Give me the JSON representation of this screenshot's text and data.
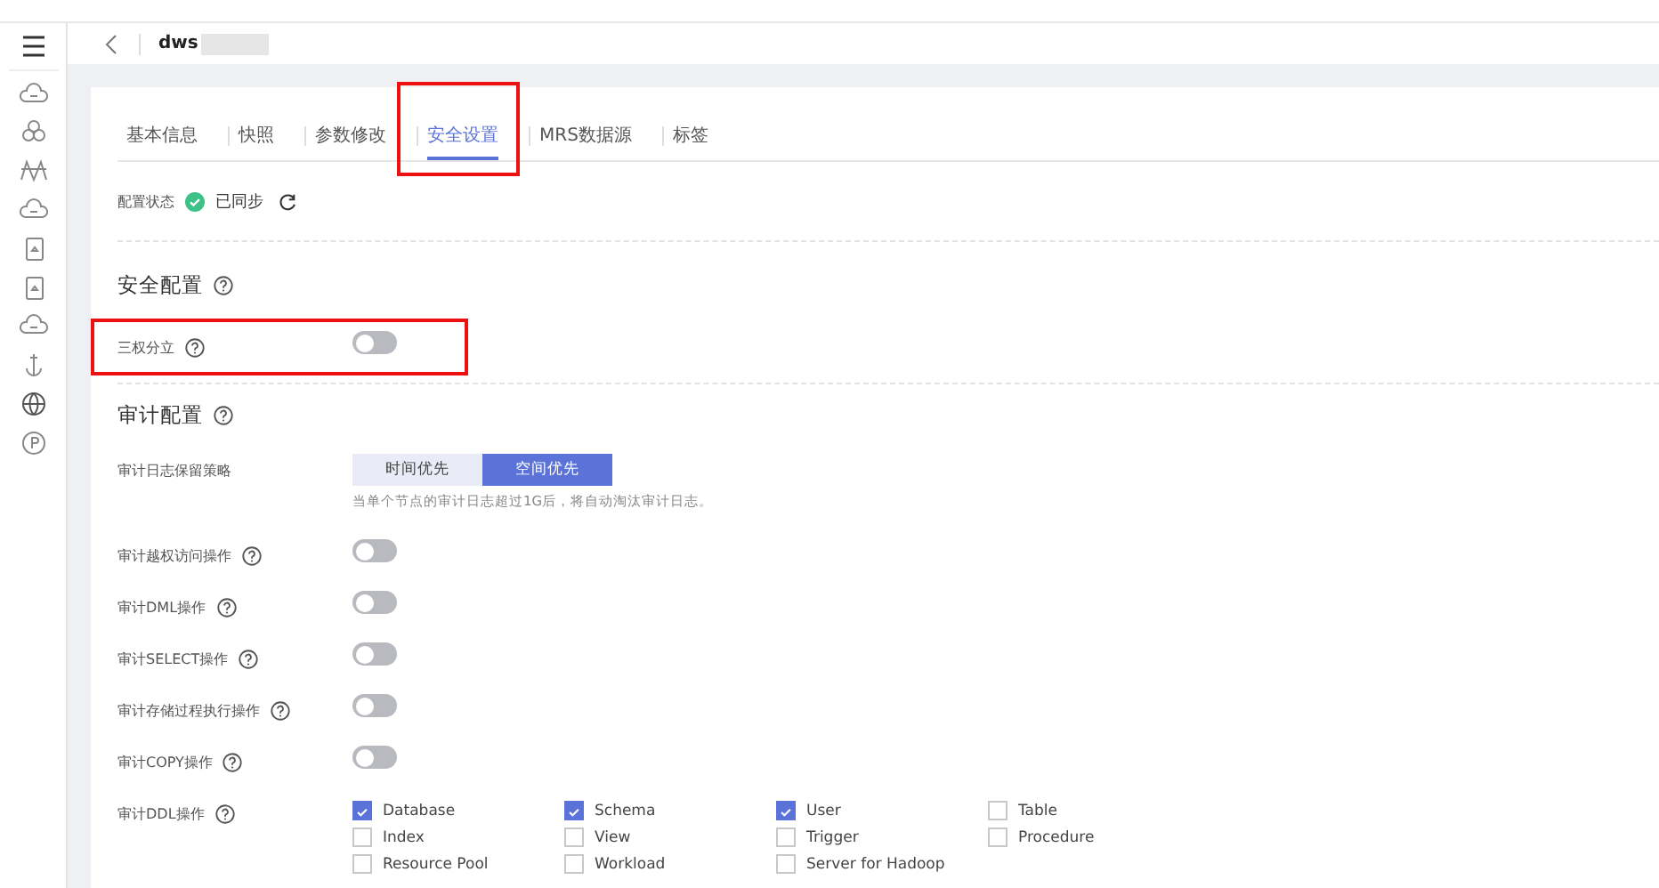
{
  "sidebar": {
    "items": [
      {
        "kind": "menu"
      },
      {
        "kind": "cloud"
      },
      {
        "kind": "cluster"
      },
      {
        "kind": "bridge"
      },
      {
        "kind": "cloud"
      },
      {
        "kind": "device"
      },
      {
        "kind": "device"
      },
      {
        "kind": "cloud"
      },
      {
        "kind": "anchor"
      },
      {
        "kind": "globe"
      },
      {
        "kind": "parking"
      }
    ]
  },
  "header": {
    "title": "dws"
  },
  "tabs": [
    {
      "label": "基本信息",
      "selected": false,
      "highlight": false
    },
    {
      "label": "快照",
      "selected": false,
      "highlight": false
    },
    {
      "label": "参数修改",
      "selected": false,
      "highlight": false
    },
    {
      "label": "安全设置",
      "selected": true,
      "highlight": true
    },
    {
      "label": "MRS数据源",
      "selected": false,
      "highlight": false
    },
    {
      "label": "标签",
      "selected": false,
      "highlight": false
    }
  ],
  "config_status": {
    "label": "配置状态",
    "status": "已同步"
  },
  "sections": [
    {
      "title": "安全配置",
      "rows": [
        {
          "kind": "toggle",
          "label": "三权分立",
          "help": true,
          "on": false,
          "highlight": true
        }
      ]
    },
    {
      "title": "审计配置",
      "rows": [
        {
          "kind": "segmented",
          "label": "审计日志保留策略",
          "help": false,
          "highlight": false,
          "options": [
            {
              "label": "时间优先",
              "selected": false
            },
            {
              "label": "空间优先",
              "selected": true
            }
          ],
          "hint": "当单个节点的审计日志超过1G后，将自动淘汰审计日志。"
        },
        {
          "kind": "toggle",
          "label": "审计越权访问操作",
          "help": true,
          "on": false,
          "highlight": false
        },
        {
          "kind": "toggle",
          "label": "审计DML操作",
          "help": true,
          "on": false,
          "highlight": false
        },
        {
          "kind": "toggle",
          "label": "审计SELECT操作",
          "help": true,
          "on": false,
          "highlight": false
        },
        {
          "kind": "toggle",
          "label": "审计存储过程执行操作",
          "help": true,
          "on": false,
          "highlight": false
        },
        {
          "kind": "toggle",
          "label": "审计COPY操作",
          "help": true,
          "on": false,
          "highlight": false
        },
        {
          "kind": "checkboxes",
          "label": "审计DDL操作",
          "help": true,
          "highlight": false,
          "options": [
            {
              "label": "Database",
              "checked": true
            },
            {
              "label": "Schema",
              "checked": true
            },
            {
              "label": "User",
              "checked": true
            },
            {
              "label": "Table",
              "checked": false
            },
            {
              "label": "Index",
              "checked": false
            },
            {
              "label": "View",
              "checked": false
            },
            {
              "label": "Trigger",
              "checked": false
            },
            {
              "label": "Procedure",
              "checked": false
            },
            {
              "label": "Resource Pool",
              "checked": false
            },
            {
              "label": "Workload",
              "checked": false
            },
            {
              "label": "Server for Hadoop",
              "checked": false
            }
          ]
        }
      ]
    }
  ]
}
